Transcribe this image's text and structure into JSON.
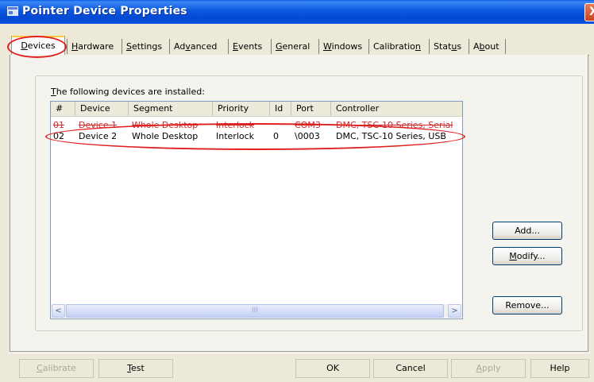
{
  "window": {
    "title": "Pointer Device Properties",
    "close_glyph": "X"
  },
  "tabs": [
    {
      "label": "Devices",
      "mnemonic": "D",
      "rest": "evices"
    },
    {
      "label": "Hardware",
      "mnemonic": "H",
      "rest": "ardware"
    },
    {
      "label": "Settings",
      "mnemonic": "S",
      "rest": "ettings"
    },
    {
      "label": "Advanced",
      "pre": "Ad",
      "mnemonic": "v",
      "rest": "anced"
    },
    {
      "label": "Events",
      "mnemonic": "E",
      "rest": "vents"
    },
    {
      "label": "General",
      "mnemonic": "G",
      "rest": "eneral"
    },
    {
      "label": "Windows",
      "mnemonic": "W",
      "rest": "indows"
    },
    {
      "label": "Calibration",
      "pre": "Calibratio",
      "mnemonic": "n",
      "rest": ""
    },
    {
      "label": "Status",
      "pre": "Stat",
      "mnemonic": "u",
      "rest": "s"
    },
    {
      "label": "About",
      "pre": "A",
      "mnemonic": "b",
      "rest": "out"
    }
  ],
  "devices": {
    "caption_pre": "T",
    "caption_rest": "he following devices are installed:",
    "columns": [
      "#",
      "Device",
      "Segment",
      "Priority",
      "Id",
      "Port",
      "Controller"
    ],
    "rows": [
      {
        "num": "01",
        "device": "Device 1",
        "segment": "Whole Desktop",
        "priority": "Interlock",
        "id": "",
        "port": "COM3",
        "controller": "DMC, TSC-10 Series, Serial",
        "struck": true
      },
      {
        "num": "02",
        "device": "Device 2",
        "segment": "Whole Desktop",
        "priority": "Interlock",
        "id": "0",
        "port": "\\0003",
        "controller": "DMC, TSC-10 Series, USB",
        "struck": false
      }
    ],
    "scroll_left": "<",
    "scroll_right": ">",
    "scroll_grip": "III",
    "buttons": {
      "add_pre": "Add",
      "add_mn": "",
      "add_post": "...",
      "modify_mn": "M",
      "modify_rest": "odify...",
      "remove": "Remove..."
    }
  },
  "footer": {
    "calibrate_mn": "C",
    "calibrate_rest": "alibrate",
    "test_mn": "T",
    "test_rest": "est",
    "ok": "OK",
    "cancel": "Cancel",
    "apply_mn": "A",
    "apply_rest": "pply",
    "help": "Help"
  },
  "colors": {
    "title_bar": "#0a58e0",
    "dialog_bg": "#ece9d8",
    "strike_red": "#cc2a2a",
    "annotation_red": "#e02020"
  }
}
